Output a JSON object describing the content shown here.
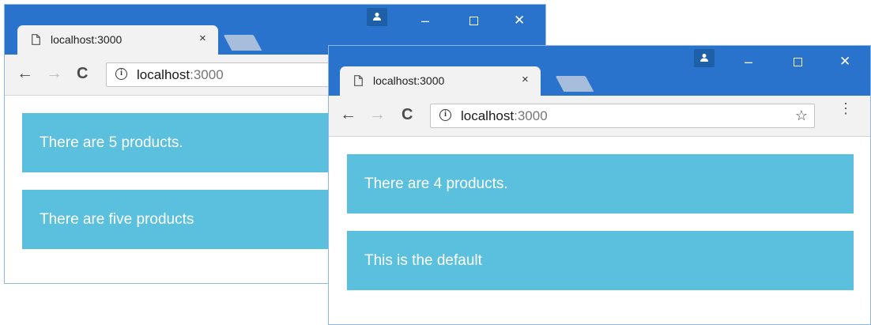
{
  "back_window": {
    "tab": {
      "title": "localhost:3000",
      "close": "×"
    },
    "address": {
      "host": "localhost",
      "port": ":3000"
    },
    "nav": {
      "back": "←",
      "forward": "→",
      "reload": "C"
    },
    "window_controls": {
      "minimize": "–",
      "close": "✕"
    },
    "panels": [
      "There are 5 products.",
      "There are five products"
    ]
  },
  "front_window": {
    "tab": {
      "title": "localhost:3000",
      "close": "×"
    },
    "address": {
      "host": "localhost",
      "port": ":3000"
    },
    "nav": {
      "back": "←",
      "forward": "→",
      "reload": "C"
    },
    "window_controls": {
      "minimize": "–",
      "close": "✕"
    },
    "toolbar_extra": {
      "bookmark": "☆",
      "menu": "⋮"
    },
    "panels": [
      "There are 4 products.",
      "This is the default"
    ]
  },
  "colors": {
    "titlebar": "#2a73cc",
    "panel": "#5bc0de",
    "toolbar": "#f2f2f2"
  },
  "icons": [
    "page-icon",
    "info-icon",
    "profile-icon",
    "star-icon",
    "menu-icon"
  ]
}
